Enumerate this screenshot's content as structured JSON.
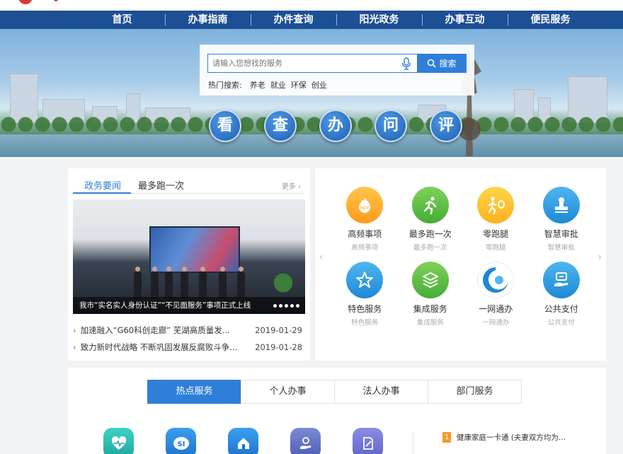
{
  "nav": [
    "首页",
    "办事指南",
    "办件查询",
    "阳光政务",
    "办事互动",
    "便民服务"
  ],
  "search": {
    "placeholder": "请输入您想找的服务",
    "button": "搜索",
    "hot_label": "热门搜索:",
    "hot_terms": [
      "养老",
      "就业",
      "环保",
      "创业"
    ]
  },
  "quick_circles": [
    "看",
    "查",
    "办",
    "问",
    "评"
  ],
  "news": {
    "tabs": [
      "政务要闻",
      "最多跑一次"
    ],
    "more": "更多",
    "caption": "我市“实名实人身份认证”“不见面服务”事项正式上线",
    "items": [
      {
        "title": "加速融入“G60科创走廊” 芜湖高质量发...",
        "date": "2019-01-29"
      },
      {
        "title": "致力新时代战略 不断巩固发展反腐败斗争...",
        "date": "2019-01-28"
      }
    ]
  },
  "services": [
    {
      "name": "高频事项",
      "sub": "高频事项",
      "icon": "hot-flame-icon",
      "color": "#ff9b1f"
    },
    {
      "name": "最多跑一次",
      "sub": "最多跑一次",
      "icon": "running-person-icon",
      "color": "#45ad35"
    },
    {
      "name": "零跑腿",
      "sub": "零跑腿",
      "icon": "walking-zero-icon",
      "color": "#ffb11f"
    },
    {
      "name": "智慧审批",
      "sub": "智慧审批",
      "icon": "stamp-icon",
      "color": "#1e88d6"
    },
    {
      "name": "特色服务",
      "sub": "特色服务",
      "icon": "star-icon",
      "color": "#1e88d6"
    },
    {
      "name": "集成服务",
      "sub": "集成服务",
      "icon": "layers-icon",
      "color": "#45ad35"
    },
    {
      "name": "一网通办",
      "sub": "一网通办",
      "icon": "swirl-logo-icon",
      "color": "#1e88d6"
    },
    {
      "name": "公共支付",
      "sub": "公共支付",
      "icon": "payment-hand-icon",
      "color": "#1e88d6"
    }
  ],
  "bottom": {
    "tabs": [
      "热点服务",
      "个人办事",
      "法人办事",
      "部门服务"
    ],
    "icons": [
      "heart-monitor-icon",
      "social-security-icon",
      "house-icon",
      "hand-coin-icon",
      "document-edit-icon"
    ],
    "hot_item": {
      "rank": "1",
      "text": "健康家庭一卡通 (夫妻双方均为..."
    }
  }
}
